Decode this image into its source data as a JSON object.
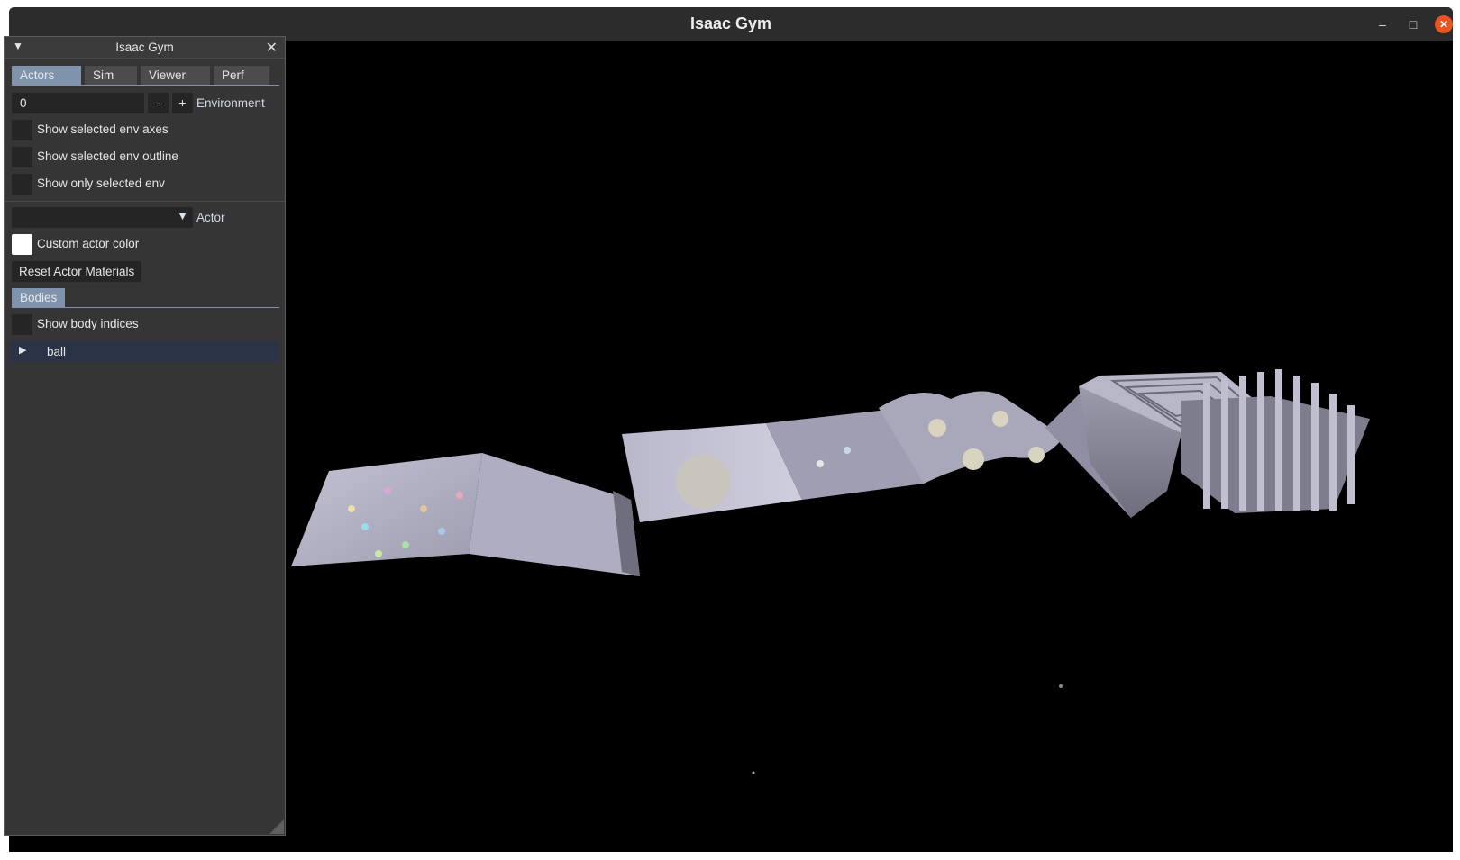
{
  "window": {
    "title": "Isaac Gym"
  },
  "panel": {
    "title": "Isaac Gym",
    "tabs": [
      "Actors",
      "Sim",
      "Viewer",
      "Perf"
    ],
    "active_tab": "Actors",
    "environment": {
      "value": "0",
      "minus": "-",
      "plus": "+",
      "label": "Environment"
    },
    "checkboxes": {
      "show_axes": "Show selected env axes",
      "show_outline": "Show selected env outline",
      "show_only": "Show only selected env"
    },
    "actor": {
      "selected": "",
      "label": "Actor"
    },
    "custom_color_label": "Custom actor color",
    "reset_button": "Reset Actor Materials",
    "bodies_tab": "Bodies",
    "show_body_indices": "Show body indices",
    "tree_items": [
      "ball"
    ]
  },
  "colors": {
    "accent": "#7f93ad",
    "close_button": "#e95420",
    "selected_row": "#2b3347"
  },
  "icons": [
    "collapse-triangle-icon",
    "close-icon",
    "dropdown-arrow-icon",
    "expand-arrow-icon",
    "minimize-icon",
    "maximize-icon"
  ]
}
